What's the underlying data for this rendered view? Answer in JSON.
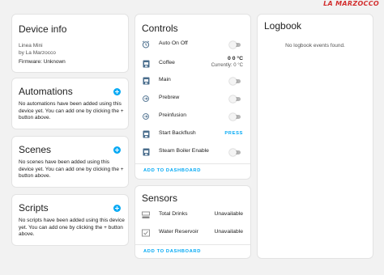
{
  "watermark": "LA MARZOCCO",
  "device_info": {
    "title": "Device info",
    "model": "Linea Mini",
    "manufacturer": "by La Marzocco",
    "firmware": "Firmware: Unknown"
  },
  "automations": {
    "title": "Automations",
    "empty_text": "No automations have been added using this device yet. You can add one by clicking the + button above."
  },
  "scenes": {
    "title": "Scenes",
    "empty_text": "No scenes have been added using this device yet. You can add one by clicking the + button above."
  },
  "scripts": {
    "title": "Scripts",
    "empty_text": "No scripts have been added using this device yet. You can add one by clicking the + button above."
  },
  "controls": {
    "title": "Controls",
    "items": [
      {
        "label": "Auto On Off",
        "icon": "clock-icon",
        "control": "toggle",
        "on": false
      },
      {
        "label": "Coffee",
        "icon": "coffee-machine-icon",
        "control": "thermostat",
        "target": "0 0 °C",
        "current": "Currently: 0 °C"
      },
      {
        "label": "Main",
        "icon": "coffee-machine-icon",
        "control": "toggle",
        "on": false
      },
      {
        "label": "Prebrew",
        "icon": "water-pump-icon",
        "control": "toggle",
        "on": false
      },
      {
        "label": "Preinfusion",
        "icon": "water-pump-icon",
        "control": "toggle",
        "on": false
      },
      {
        "label": "Start Backflush",
        "icon": "coffee-machine-icon",
        "control": "button",
        "button_label": "PRESS"
      },
      {
        "label": "Steam Boiler Enable",
        "icon": "coffee-machine-icon",
        "control": "toggle",
        "on": false
      }
    ],
    "add_label": "ADD TO DASHBOARD"
  },
  "sensors": {
    "title": "Sensors",
    "items": [
      {
        "label": "Total Drinks",
        "icon": "tray-icon",
        "state": "Unavailable"
      },
      {
        "label": "Water Reservoir",
        "icon": "water-check-icon",
        "state": "Unavailable"
      }
    ],
    "add_label": "ADD TO DASHBOARD"
  },
  "logbook": {
    "title": "Logbook",
    "empty_text": "No logbook events found."
  },
  "colors": {
    "accent": "#03a9f4",
    "watermark": "#d32f2f",
    "icon": "#4a6d8c"
  }
}
